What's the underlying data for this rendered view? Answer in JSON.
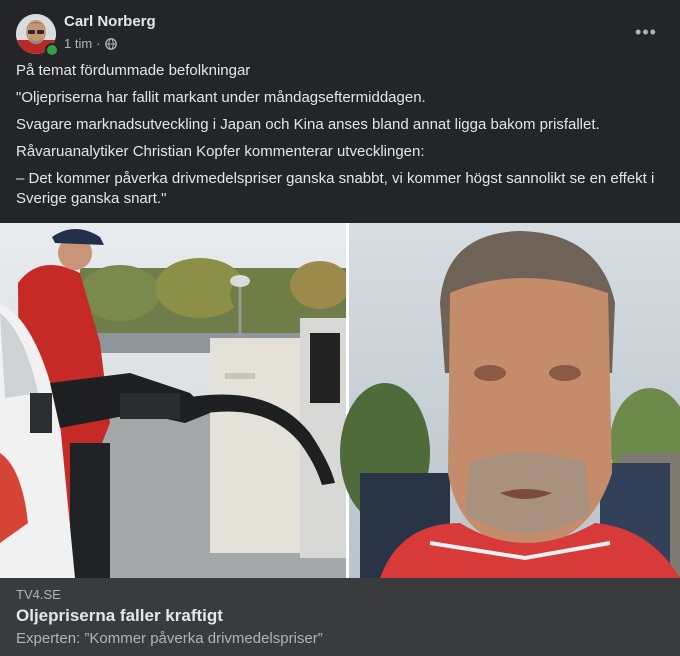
{
  "post": {
    "author": "Carl Norberg",
    "time": "1 tim",
    "separator": "·",
    "more_label": "•••",
    "paragraphs": [
      "På temat fördummade befolkningar",
      "\"Oljepriserna har fallit markant under måndagseftermiddagen.",
      "Svagare marknadsutveckling i Japan och Kina anses bland annat ligga bakom prisfallet.",
      "Råvaruanalytiker Christian Kopfer kommenterar utvecklingen:",
      "– Det kommer påverka drivmedelspriser ganska snabbt, vi kommer högst sannolikt se en effekt i Sverige ganska snart.\""
    ]
  },
  "link_preview": {
    "domain": "TV4.SE",
    "title": "Oljepriserna faller kraftigt",
    "subtitle": "Experten: ”Kommer påverka drivmedelspriser”"
  },
  "icons": {
    "privacy": "globe-icon",
    "more": "more-options-icon",
    "online": "online-status-dot"
  },
  "colors": {
    "background": "#242526",
    "card_footer": "#3a3b3c",
    "text_primary": "#e4e6eb",
    "text_secondary": "#b0b3b8",
    "online": "#31a24c"
  }
}
